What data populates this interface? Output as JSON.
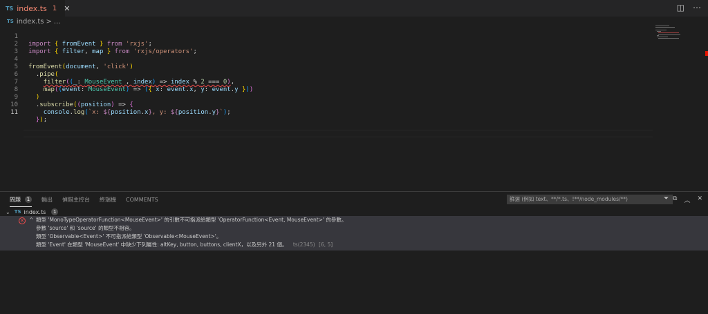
{
  "tab": {
    "badge": "TS",
    "name": "index.ts",
    "problem_count": "1",
    "close": "✕"
  },
  "breadcrumb": {
    "badge": "TS",
    "file": "index.ts",
    "sep": ">",
    "more": "..."
  },
  "editor": {
    "line_numbers": [
      "1",
      "2",
      "3",
      "4",
      "5",
      "6",
      "7",
      "8",
      "9",
      "10",
      "11"
    ],
    "current_line": 11
  },
  "panel": {
    "tabs": [
      {
        "label": "問題",
        "badge": "1"
      },
      {
        "label": "輸出"
      },
      {
        "label": "偵錯主控台"
      },
      {
        "label": "終端機"
      },
      {
        "label": "COMMENTS"
      }
    ],
    "filter_placeholder": "篩選 (例如 text、**/*.ts、!**/node_modules/**)",
    "file": {
      "badge": "TS",
      "name": "index.ts",
      "count": "1"
    },
    "problem": {
      "lines": [
        "類型 'MonoTypeOperatorFunction<MouseEvent>' 的引數不可指派給類型 'OperatorFunction<Event, MouseEvent>' 的參數。",
        "參數 'source' 和 'source' 的類型不相容。",
        "類型 'Observable<Event>' 不可指派給類型 'Observable<MouseEvent>'。",
        "類型 'Event' 在類型 'MouseEvent' 中缺少下列屬性: altKey, button, buttons, clientX，以及另外 21 個。"
      ],
      "code": "ts(2345)",
      "position": "[6, 5]"
    }
  },
  "colors": {
    "error": "#f14c4c",
    "editor_bg": "#1e1e1e",
    "tabbar_bg": "#252526"
  },
  "icons": [
    "split-editor-icon",
    "more-actions-icon",
    "filter-icon",
    "collapse-all-icon",
    "close-panel-icon",
    "error-icon",
    "chevron-down-icon"
  ]
}
